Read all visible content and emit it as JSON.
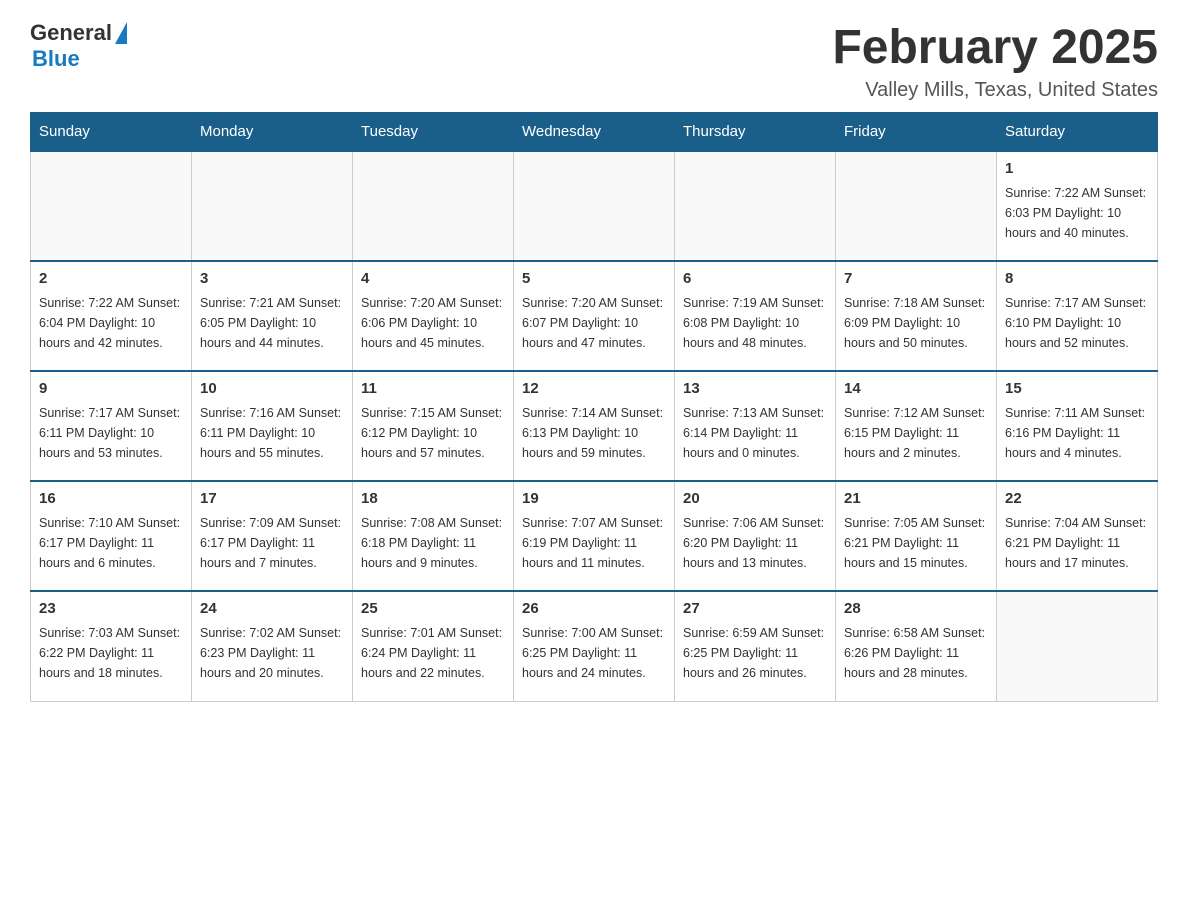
{
  "logo": {
    "general": "General",
    "blue": "Blue"
  },
  "header": {
    "title": "February 2025",
    "subtitle": "Valley Mills, Texas, United States"
  },
  "days_of_week": [
    "Sunday",
    "Monday",
    "Tuesday",
    "Wednesday",
    "Thursday",
    "Friday",
    "Saturday"
  ],
  "weeks": [
    [
      {
        "day": "",
        "info": ""
      },
      {
        "day": "",
        "info": ""
      },
      {
        "day": "",
        "info": ""
      },
      {
        "day": "",
        "info": ""
      },
      {
        "day": "",
        "info": ""
      },
      {
        "day": "",
        "info": ""
      },
      {
        "day": "1",
        "info": "Sunrise: 7:22 AM\nSunset: 6:03 PM\nDaylight: 10 hours and 40 minutes."
      }
    ],
    [
      {
        "day": "2",
        "info": "Sunrise: 7:22 AM\nSunset: 6:04 PM\nDaylight: 10 hours and 42 minutes."
      },
      {
        "day": "3",
        "info": "Sunrise: 7:21 AM\nSunset: 6:05 PM\nDaylight: 10 hours and 44 minutes."
      },
      {
        "day": "4",
        "info": "Sunrise: 7:20 AM\nSunset: 6:06 PM\nDaylight: 10 hours and 45 minutes."
      },
      {
        "day": "5",
        "info": "Sunrise: 7:20 AM\nSunset: 6:07 PM\nDaylight: 10 hours and 47 minutes."
      },
      {
        "day": "6",
        "info": "Sunrise: 7:19 AM\nSunset: 6:08 PM\nDaylight: 10 hours and 48 minutes."
      },
      {
        "day": "7",
        "info": "Sunrise: 7:18 AM\nSunset: 6:09 PM\nDaylight: 10 hours and 50 minutes."
      },
      {
        "day": "8",
        "info": "Sunrise: 7:17 AM\nSunset: 6:10 PM\nDaylight: 10 hours and 52 minutes."
      }
    ],
    [
      {
        "day": "9",
        "info": "Sunrise: 7:17 AM\nSunset: 6:11 PM\nDaylight: 10 hours and 53 minutes."
      },
      {
        "day": "10",
        "info": "Sunrise: 7:16 AM\nSunset: 6:11 PM\nDaylight: 10 hours and 55 minutes."
      },
      {
        "day": "11",
        "info": "Sunrise: 7:15 AM\nSunset: 6:12 PM\nDaylight: 10 hours and 57 minutes."
      },
      {
        "day": "12",
        "info": "Sunrise: 7:14 AM\nSunset: 6:13 PM\nDaylight: 10 hours and 59 minutes."
      },
      {
        "day": "13",
        "info": "Sunrise: 7:13 AM\nSunset: 6:14 PM\nDaylight: 11 hours and 0 minutes."
      },
      {
        "day": "14",
        "info": "Sunrise: 7:12 AM\nSunset: 6:15 PM\nDaylight: 11 hours and 2 minutes."
      },
      {
        "day": "15",
        "info": "Sunrise: 7:11 AM\nSunset: 6:16 PM\nDaylight: 11 hours and 4 minutes."
      }
    ],
    [
      {
        "day": "16",
        "info": "Sunrise: 7:10 AM\nSunset: 6:17 PM\nDaylight: 11 hours and 6 minutes."
      },
      {
        "day": "17",
        "info": "Sunrise: 7:09 AM\nSunset: 6:17 PM\nDaylight: 11 hours and 7 minutes."
      },
      {
        "day": "18",
        "info": "Sunrise: 7:08 AM\nSunset: 6:18 PM\nDaylight: 11 hours and 9 minutes."
      },
      {
        "day": "19",
        "info": "Sunrise: 7:07 AM\nSunset: 6:19 PM\nDaylight: 11 hours and 11 minutes."
      },
      {
        "day": "20",
        "info": "Sunrise: 7:06 AM\nSunset: 6:20 PM\nDaylight: 11 hours and 13 minutes."
      },
      {
        "day": "21",
        "info": "Sunrise: 7:05 AM\nSunset: 6:21 PM\nDaylight: 11 hours and 15 minutes."
      },
      {
        "day": "22",
        "info": "Sunrise: 7:04 AM\nSunset: 6:21 PM\nDaylight: 11 hours and 17 minutes."
      }
    ],
    [
      {
        "day": "23",
        "info": "Sunrise: 7:03 AM\nSunset: 6:22 PM\nDaylight: 11 hours and 18 minutes."
      },
      {
        "day": "24",
        "info": "Sunrise: 7:02 AM\nSunset: 6:23 PM\nDaylight: 11 hours and 20 minutes."
      },
      {
        "day": "25",
        "info": "Sunrise: 7:01 AM\nSunset: 6:24 PM\nDaylight: 11 hours and 22 minutes."
      },
      {
        "day": "26",
        "info": "Sunrise: 7:00 AM\nSunset: 6:25 PM\nDaylight: 11 hours and 24 minutes."
      },
      {
        "day": "27",
        "info": "Sunrise: 6:59 AM\nSunset: 6:25 PM\nDaylight: 11 hours and 26 minutes."
      },
      {
        "day": "28",
        "info": "Sunrise: 6:58 AM\nSunset: 6:26 PM\nDaylight: 11 hours and 28 minutes."
      },
      {
        "day": "",
        "info": ""
      }
    ]
  ]
}
